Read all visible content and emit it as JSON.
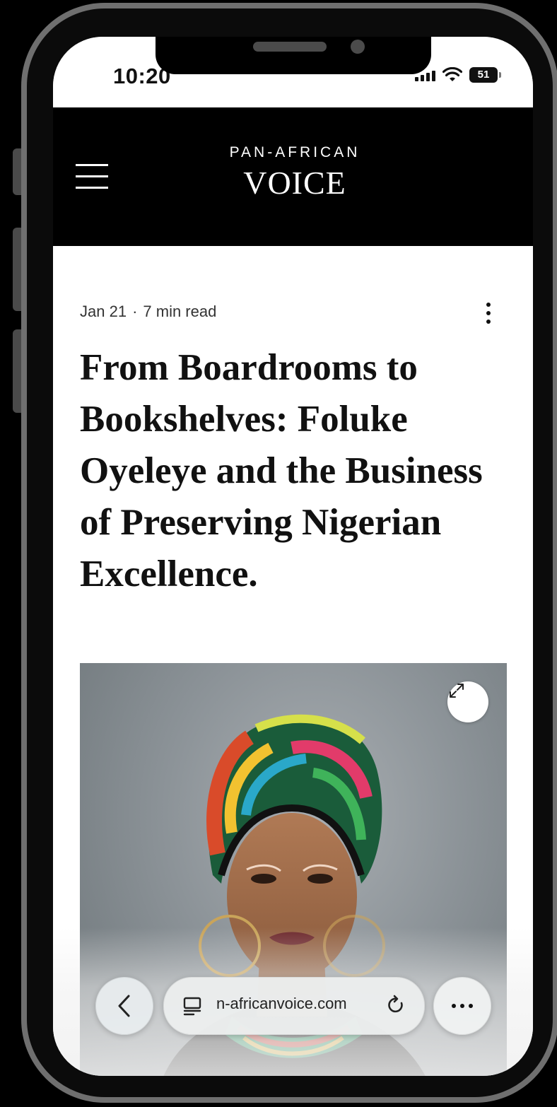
{
  "status_bar": {
    "time": "10:20",
    "battery": "51"
  },
  "site_header": {
    "logo_top": "PAN-AFRICAN",
    "logo_main": "VOICE"
  },
  "article": {
    "date": "Jan 21",
    "separator": "·",
    "read_time": "7 min read",
    "headline": "From Boardrooms to Bookshelves: Foluke Oyeleye and the Business of Preserving Nigerian Excellence."
  },
  "browser": {
    "url": "n-africanvoice.com"
  },
  "icons": {
    "menu": "hamburger-menu-icon",
    "more_vert": "more-vertical-icon",
    "expand": "expand-icon",
    "back": "chevron-left-icon",
    "reader": "reader-icon",
    "reload": "reload-icon",
    "more_horiz": "more-horizontal-icon"
  }
}
